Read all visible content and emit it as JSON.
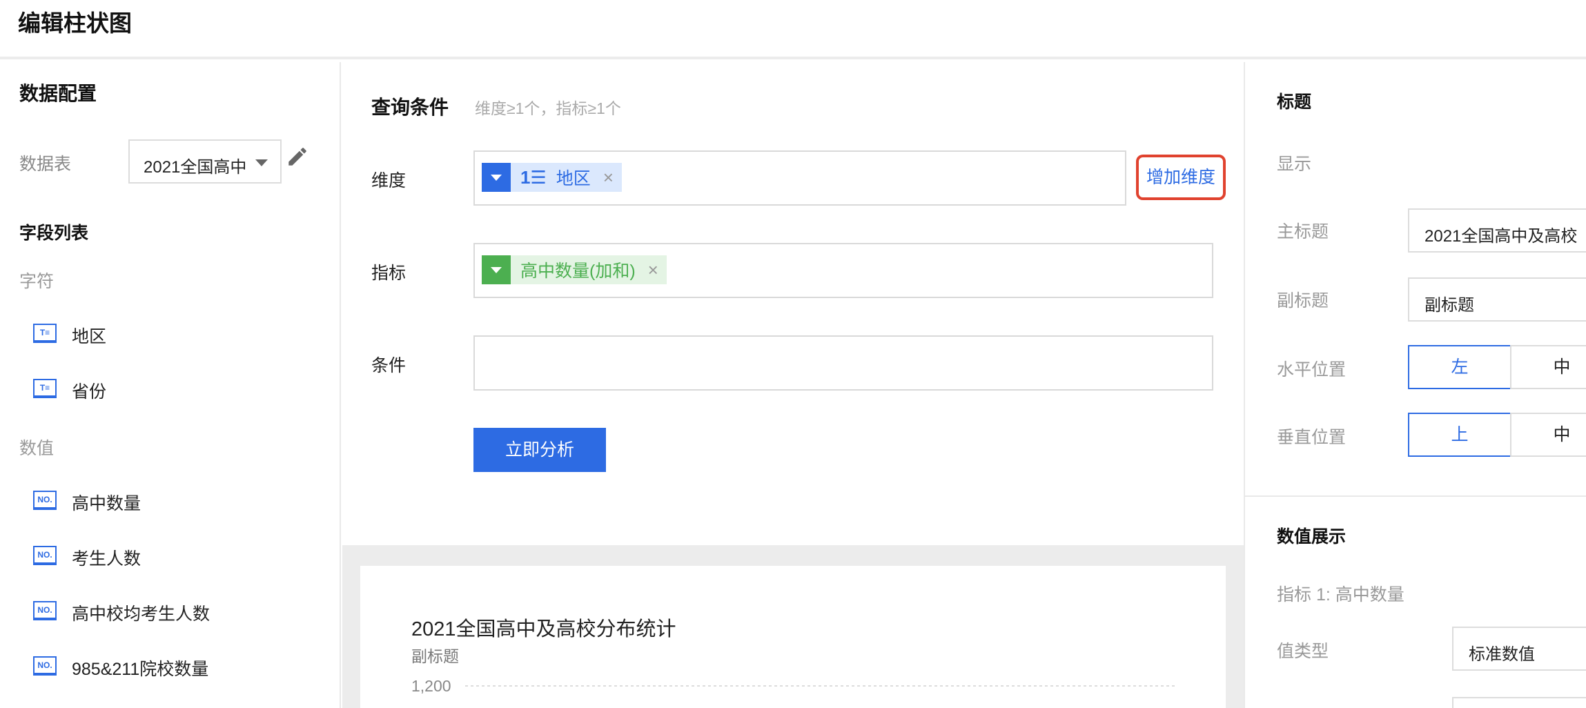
{
  "header": {
    "title": "编辑柱状图"
  },
  "left": {
    "title": "数据配置",
    "table_label": "数据表",
    "table_value": "2021全国高中",
    "fields_title": "字段列表",
    "group_text": "字符",
    "group_number": "数值",
    "text_fields": [
      "地区",
      "省份"
    ],
    "number_fields": [
      "高中数量",
      "考生人数",
      "高中校均考生人数",
      "985&211院校数量"
    ],
    "text_icon": "T≡",
    "number_icon": "NO."
  },
  "query": {
    "title": "查询条件",
    "hint": "维度≥1个，指标≥1个",
    "dimension_label": "维度",
    "dimension_tag": "地区",
    "dimension_seq": "1☰",
    "add_dimension": "增加维度",
    "metric_label": "指标",
    "metric_tag": "高中数量(加和)",
    "condition_label": "条件",
    "run_button": "立即分析",
    "remove": "×"
  },
  "chart": {
    "title": "2021全国高中及高校分布统计",
    "subtitle": "副标题",
    "first_tick": "1,200"
  },
  "right": {
    "title_section": "标题",
    "show_label": "显示",
    "main_title_label": "主标题",
    "main_title_value": "2021全国高中及高校",
    "sub_title_label": "副标题",
    "sub_title_value": "副标题",
    "h_pos_label": "水平位置",
    "h_left": "左",
    "h_center": "中",
    "v_pos_label": "垂直位置",
    "v_top": "上",
    "v_center": "中",
    "value_section": "数值展示",
    "metric_1": "指标 1: 高中数量",
    "value_type_label": "值类型",
    "value_type": "标准数值"
  },
  "colors": {
    "accent": "#2d6be3",
    "metric": "#4caf50",
    "highlight": "#e0422e"
  }
}
